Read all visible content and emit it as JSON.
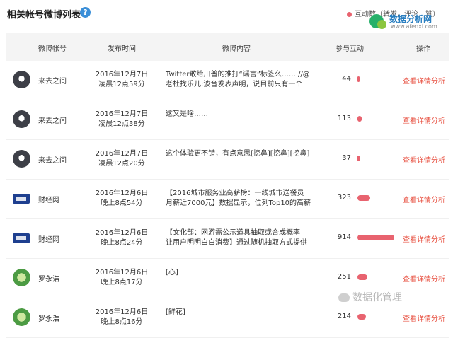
{
  "header": {
    "title": "相关帐号微博列表",
    "help_icon": "?",
    "legend_label": "互动数（转发，评论，赞）",
    "accent_color": "#e8636f"
  },
  "watermark": {
    "brand": "数据分析网",
    "url": "www.afenxi.com",
    "footer": "数据化管理"
  },
  "table": {
    "columns": [
      "微博帐号",
      "发布时间",
      "微博内容",
      "参与互动",
      "操作"
    ],
    "max_interactions": 914,
    "rows": [
      {
        "avatar": "dark",
        "name": "来去之间",
        "time1": "2016年12月7日",
        "time2": "凌晨12点59分",
        "content": "Twitter敢给川普的推打“谣言”标签么…… //@\n老杜找乐儿:波音发表声明，说目前只有一个",
        "count": 44,
        "action": "查看详情分析"
      },
      {
        "avatar": "dark",
        "name": "来去之间",
        "time1": "2016年12月7日",
        "time2": "凌晨12点38分",
        "content": "这又是啥……",
        "count": 113,
        "action": "查看详情分析"
      },
      {
        "avatar": "dark",
        "name": "来去之间",
        "time1": "2016年12月7日",
        "time2": "凌晨12点20分",
        "content": "这个体验更不错，有点意思[挖鼻][挖鼻][挖鼻]",
        "count": 37,
        "action": "查看详情分析"
      },
      {
        "avatar": "cj",
        "name": "财经网",
        "time1": "2016年12月6日",
        "time2": "晚上8点54分",
        "content": "【2016城市服务业高薪榜：一线城市送餐员\n月薪近7000元】数据显示，位列Top10的高薪",
        "count": 323,
        "action": "查看详情分析"
      },
      {
        "avatar": "cj",
        "name": "财经网",
        "time1": "2016年12月6日",
        "time2": "晚上8点24分",
        "content": "【文化部：网游需公示道具抽取或合成概率\n让用户明明白白消费】通过随机抽取方式提供",
        "count": 914,
        "action": "查看详情分析"
      },
      {
        "avatar": "green",
        "name": "罗永浩",
        "time1": "2016年12月6日",
        "time2": "晚上8点17分",
        "content": "[心]",
        "count": 251,
        "action": "查看详情分析"
      },
      {
        "avatar": "green",
        "name": "罗永浩",
        "time1": "2016年12月6日",
        "time2": "晚上8点16分",
        "content": "[鲜花]",
        "count": 214,
        "action": "查看详情分析"
      }
    ]
  }
}
